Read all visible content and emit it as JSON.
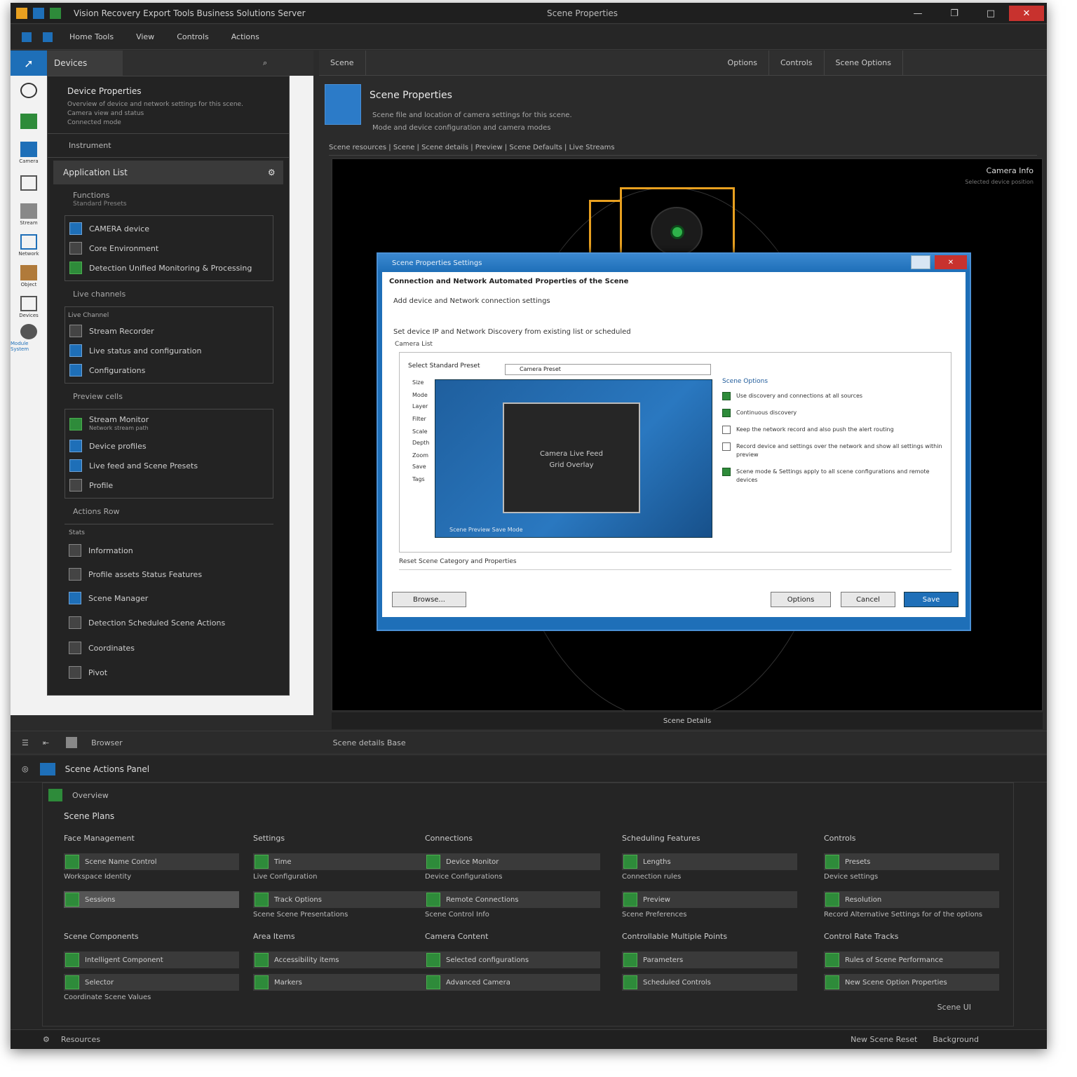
{
  "window": {
    "title": "Vision Recovery Export Tools Business Solutions Server",
    "center_title": "Scene Properties",
    "min": "—",
    "restore": "❐",
    "max": "□",
    "close": "✕"
  },
  "menu": [
    "Home Tools",
    "View",
    "Controls",
    "Actions"
  ],
  "rail": {
    "items": [
      "",
      "",
      "Camera",
      "",
      "Stream",
      "",
      "Network",
      "",
      "Object",
      "",
      "",
      "",
      "Devices",
      "Module System"
    ]
  },
  "left": {
    "tab": "Devices",
    "head_title": "Device Properties",
    "head_desc1": "Overview of device and network settings for this scene.",
    "head_desc2": "Camera view and status",
    "head_desc3": "Connected mode",
    "sub": "Instrument",
    "bar_title": "Application List",
    "g1_title": "Functions",
    "g1_sub": "Standard Presets",
    "g1": [
      "CAMERA device",
      "Core Environment",
      "Detection Unified Monitoring & Processing"
    ],
    "s2": "Live channels",
    "g2_title": "Live Channel",
    "g2": [
      "Stream Recorder",
      "Live status and configuration",
      "Configurations"
    ],
    "s3": "Preview cells",
    "g3_title": "Stream Monitor",
    "g3_sub": "Network stream path",
    "g3": [
      "Device profiles",
      "Live feed and Scene Presets",
      "Profile"
    ],
    "s4": "Actions Row",
    "g4_title": "Stats",
    "g4": [
      "Information",
      "Profile assets Status Features",
      "Scene Manager",
      "Detection Scheduled Scene Actions",
      "Coordinates",
      "Pivot"
    ]
  },
  "main": {
    "tab": "Scene",
    "tabs_right": [
      "Options",
      "Controls",
      "Scene Options"
    ],
    "title": "Scene Properties",
    "desc1": "Scene file and location of camera settings for this scene.",
    "desc2": "Mode and device configuration and camera modes",
    "crumb": "Scene resources | Scene | Scene details | Preview | Scene Defaults | Live Streams",
    "vp_label": "Camera Info",
    "vp_sub": "Selected device position",
    "vp_foot": "Scene Details"
  },
  "dialog": {
    "title": "Scene Properties Settings",
    "heading": "Connection and Network Automated Properties of the Scene",
    "sub": "Add device and Network connection settings",
    "lbl": "Set device IP and Network Discovery from existing list or scheduled",
    "lbl2": "Camera List",
    "frame_label": "Select Standard Preset",
    "input": "Camera Preset",
    "options": [
      "Size",
      "Mode",
      "Layer",
      "Filter",
      "Scale",
      "Depth",
      "Zoom",
      "Save",
      "Tags"
    ],
    "screen1": "Camera Live Feed",
    "screen2": "Grid Overlay",
    "pv_foot": "Scene Preview   Save Mode",
    "checks_title": "Scene Options",
    "checks": [
      "Use discovery and connections at all sources",
      "Continuous discovery",
      "Keep the network record and also push the alert routing",
      "Record device and settings over the network and show all settings within preview",
      "Scene mode & Settings apply to all scene configurations and remote devices"
    ],
    "note": "Reset Scene Category and Properties",
    "btn_browse": "Browse...",
    "btn_options": "Options",
    "btn_cancel": "Cancel",
    "btn_ok": "Save"
  },
  "toolstrip": {
    "l1": "Browser",
    "l2": "Scene details Base"
  },
  "bottom": {
    "title": "Scene Actions Panel",
    "sub": "Overview",
    "section": "Scene Plans",
    "cols": [
      {
        "h": "Face Management",
        "f1": "Scene Name Control",
        "c1": "Workspace Identity",
        "f2": "Sessions",
        "c2": "",
        "h2": "Scene Components",
        "f3": "Intelligent Component",
        "f4": "Selector",
        "c3": "Coordinate Scene Values",
        "sel": true
      },
      {
        "h": "Settings",
        "f1": "Time",
        "c1": "Live Configuration",
        "f2": "Track Options",
        "c2": "Scene Scene Presentations",
        "h2": "Area Items",
        "f3": "Accessibility items",
        "f4": "Markers",
        "c3": ""
      },
      {
        "h": "Connections",
        "f1": "Device Monitor",
        "c1": "Device Configurations",
        "f2": "Remote Connections",
        "c2": "Scene Control Info",
        "h2": "Camera Content",
        "f3": "Selected configurations",
        "f4": "Advanced Camera",
        "c3": ""
      },
      {
        "h": "Scheduling Features",
        "f1": "Lengths",
        "c1": "Connection rules",
        "f2": "Preview",
        "c2": "Scene Preferences",
        "h2": "Controllable Multiple Points",
        "f3": "Parameters",
        "f4": "Scheduled Controls",
        "c3": ""
      },
      {
        "h": "Controls",
        "f1": "Presets",
        "c1": "Device settings",
        "f2": "Resolution",
        "c2": "Record Alternative Settings for of the options",
        "h2": "Control Rate Tracks",
        "f3": "Rules of Scene Performance",
        "f4": "New Scene Option Properties",
        "c3": ""
      }
    ],
    "foot_right": "Scene UI"
  },
  "status": {
    "left": "Resources",
    "r1": "New Scene Reset",
    "r2": "Background"
  }
}
